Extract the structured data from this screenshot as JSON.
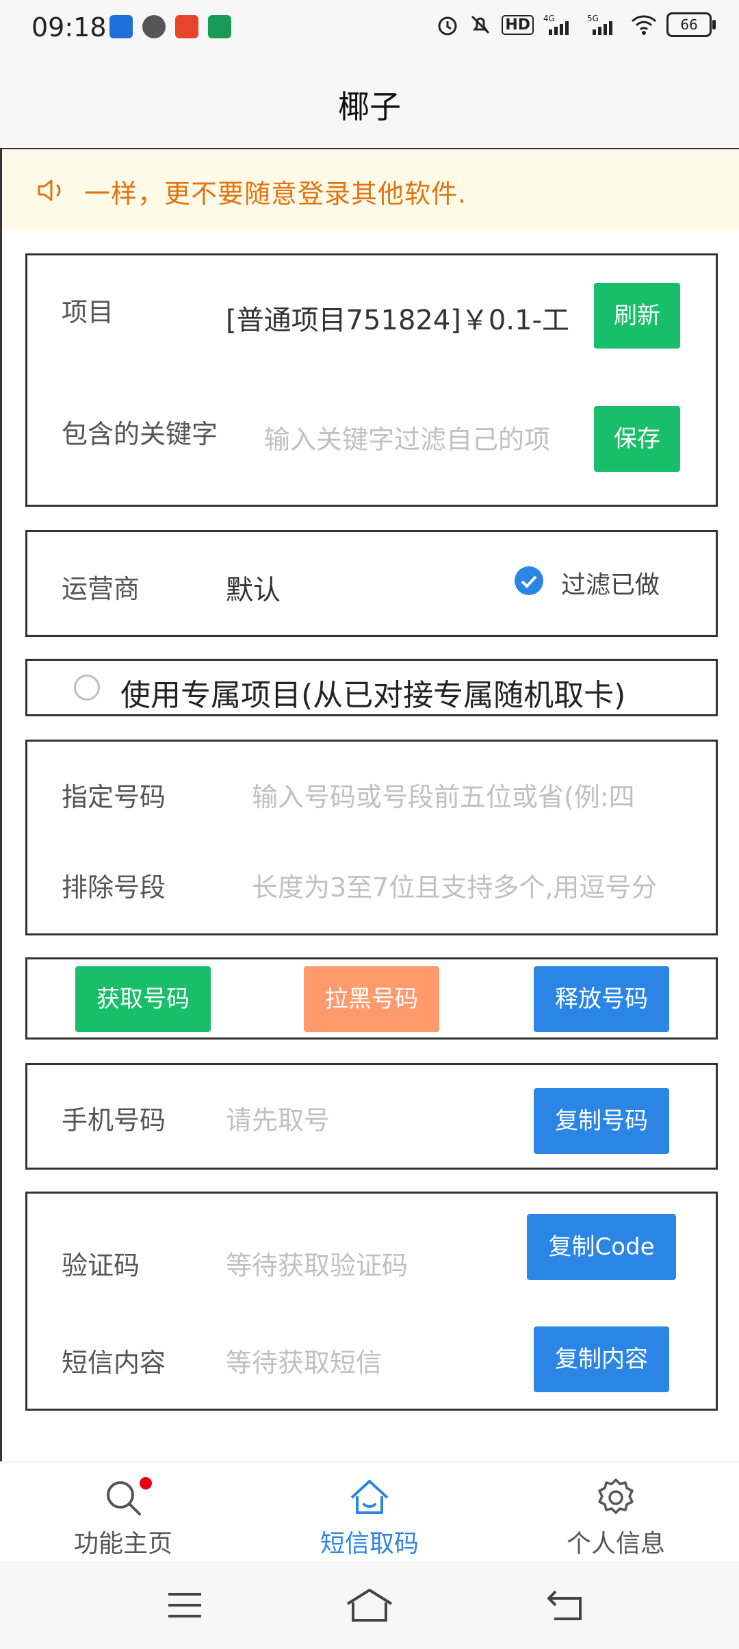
{
  "status_bar": {
    "time": "09:18",
    "battery": "66",
    "icons": [
      "alarm-icon",
      "mute-icon",
      "hd-icon",
      "signal-4g-icon",
      "signal-5g-icon",
      "wifi-icon",
      "battery-icon"
    ]
  },
  "header": {
    "title": "椰子"
  },
  "notice": {
    "text": "一样，更不要随意登录其他软件."
  },
  "project_card": {
    "project_label": "项目",
    "project_value": "[普通项目751824]￥0.1-工",
    "refresh_label": "刷新",
    "keyword_label": "包含的关键字",
    "keyword_placeholder": "输入关键字过滤自己的项",
    "save_label": "保存"
  },
  "carrier_card": {
    "carrier_label": "运营商",
    "carrier_value": "默认",
    "filter_label": "过滤已做",
    "filter_checked": true
  },
  "exclusive": {
    "label": "使用专属项目(从已对接专属随机取卡)",
    "checked": false
  },
  "number_card": {
    "specify_label": "指定号码",
    "specify_placeholder": "输入号码或号段前五位或省(例:四",
    "exclude_label": "排除号段",
    "exclude_placeholder": "长度为3至7位且支持多个,用逗号分"
  },
  "actions": {
    "get_label": "获取号码",
    "block_label": "拉黑号码",
    "release_label": "释放号码"
  },
  "phone_card": {
    "phone_label": "手机号码",
    "phone_placeholder": "请先取号",
    "copy_number_label": "复制号码"
  },
  "sms_card": {
    "code_label": "验证码",
    "code_placeholder": "等待获取验证码",
    "copy_code_label": "复制Code",
    "content_label": "短信内容",
    "content_placeholder": "等待获取短信",
    "copy_content_label": "复制内容"
  },
  "tabbar": {
    "tabs": [
      {
        "label": "功能主页",
        "icon": "search-icon",
        "badge": true
      },
      {
        "label": "短信取码",
        "icon": "home-icon",
        "active": true
      },
      {
        "label": "个人信息",
        "icon": "gear-icon"
      }
    ]
  },
  "colors": {
    "green": "#19be6b",
    "orange": "#ff9a6c",
    "blue": "#2b85e4",
    "notice_text": "#e4720e",
    "notice_bg": "#fffbe8"
  }
}
